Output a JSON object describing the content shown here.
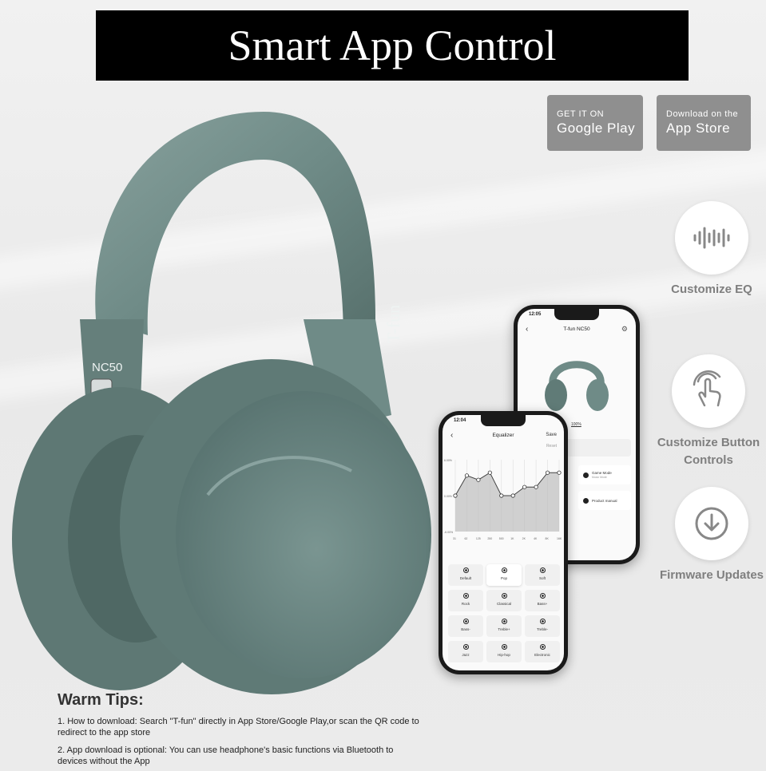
{
  "title": "Smart App Control",
  "stores": {
    "google": {
      "small": "GET IT ON",
      "big": "Google Play"
    },
    "apple": {
      "small": "Download on the",
      "big": "App Store"
    }
  },
  "features": [
    {
      "label": "Customize EQ",
      "icon": "sound-wave-icon"
    },
    {
      "label": "Customize Button Controls",
      "icon": "touch-hand-icon"
    },
    {
      "label": "Firmware Updates",
      "icon": "download-arrow-icon"
    }
  ],
  "product": {
    "brand": "T-fun",
    "model": "NC50"
  },
  "phone_back": {
    "time": "12:05",
    "title": "T-fun NC50",
    "battery": "100%",
    "tiles": [
      "Game Mode",
      "Product manual"
    ],
    "game_mode_sub": "Music Mode"
  },
  "phone_front": {
    "time": "12:04",
    "title": "Equalizer",
    "save": "Save",
    "reset": "Reset",
    "y_labels": [
      "6.00%",
      "0.00%",
      "-6.00%"
    ],
    "x_labels": [
      "31",
      "62",
      "125",
      "250",
      "500",
      "1K",
      "2K",
      "4K",
      "8K",
      "16K"
    ],
    "eq_levels": [
      0.5,
      0.78,
      0.72,
      0.82,
      0.5,
      0.5,
      0.62,
      0.62,
      0.82,
      0.82
    ],
    "presets": [
      "Default",
      "Pop",
      "Soft",
      "Rock",
      "Classical",
      "Bass+",
      "Bass-",
      "Treble+",
      "Treble-",
      "Jazz",
      "Hip-hop",
      "Electronic"
    ]
  },
  "tips": {
    "heading": "Warm Tips:",
    "line1": "1. How to download: Search \"T-fun\" directly in App Store/Google Play,or scan the QR code to redirect to the app store",
    "line2": "2. App download is optional: You can use headphone's basic functions via Bluetooth to devices without the App"
  },
  "colors": {
    "headphone": "#6f8b87",
    "headphone_dark": "#5a7571",
    "badge": "#8f8f8f",
    "feature_text": "#7f7f7f"
  }
}
